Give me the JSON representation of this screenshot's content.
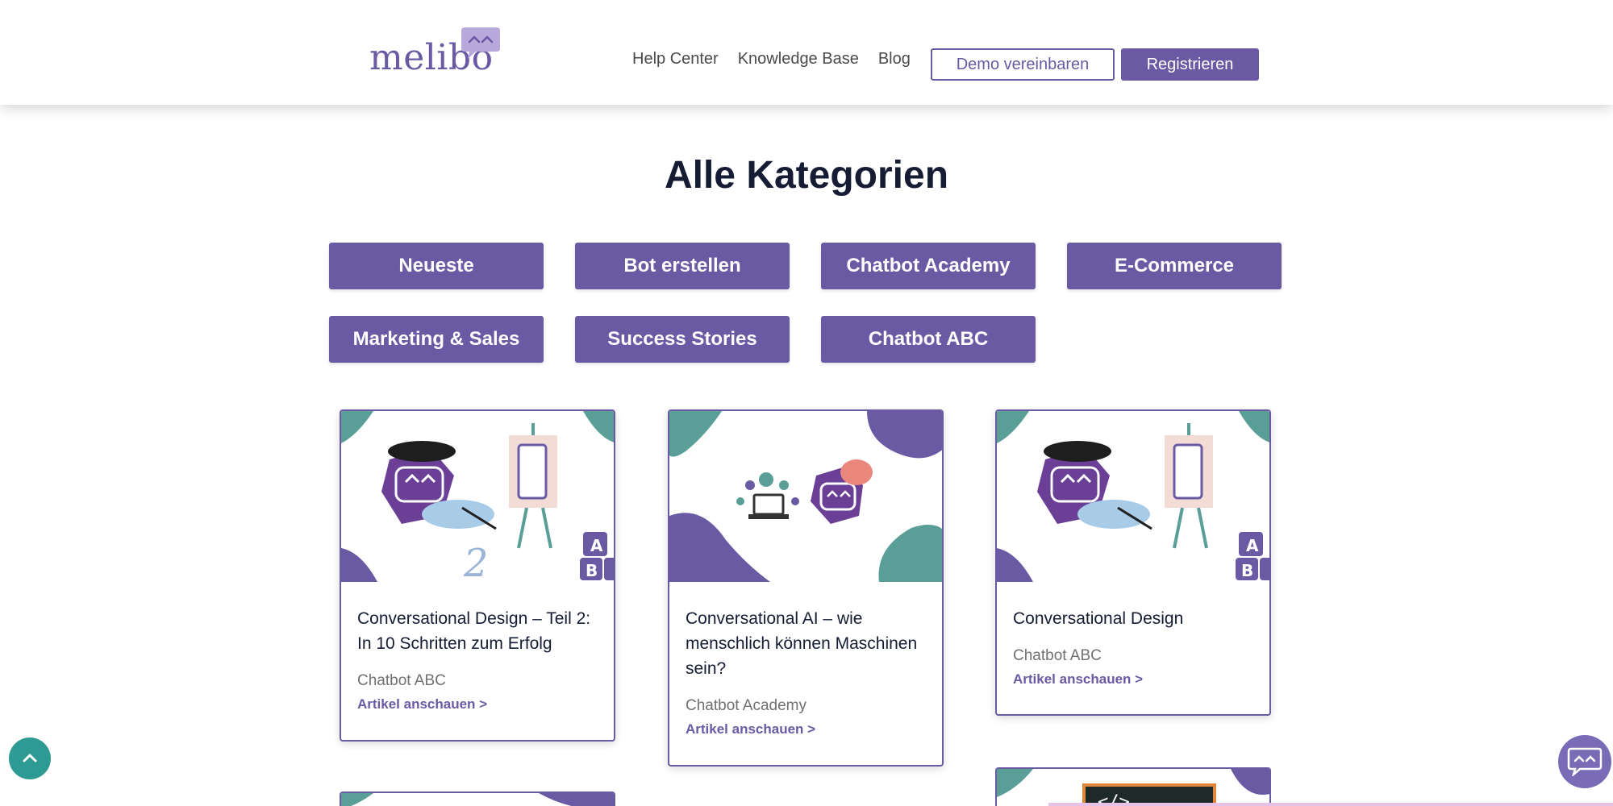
{
  "header": {
    "logo_text": "melibo",
    "nav": [
      "Help Center",
      "Knowledge Base",
      "Blog"
    ],
    "demo_button": "Demo vereinbaren",
    "register_button": "Registrieren"
  },
  "page_title": "Alle Kategorien",
  "categories": [
    "Neueste",
    "Bot erstellen",
    "Chatbot Academy",
    "E-Commerce",
    "Marketing & Sales",
    "Success Stories",
    "Chatbot ABC"
  ],
  "cards": [
    {
      "title": "Conversational Design – Teil 2: In 10 Schritten zum Erfolg",
      "category": "Chatbot ABC",
      "link": "Artikel anschauen >"
    },
    {
      "title": "Conversational AI – wie menschlich können Maschinen sein?",
      "category": "Chatbot Academy",
      "link": "Artikel anschauen >"
    },
    {
      "title": "Conversational Design",
      "category": "Chatbot ABC",
      "link": "Artikel anschauen >"
    }
  ],
  "colors": {
    "brand": "#6a5aa3",
    "teal": "#5a9f97",
    "heading": "#151c33"
  },
  "icons": {
    "to_top": "chevron-up-icon",
    "chat": "chat-bubble-icon"
  }
}
